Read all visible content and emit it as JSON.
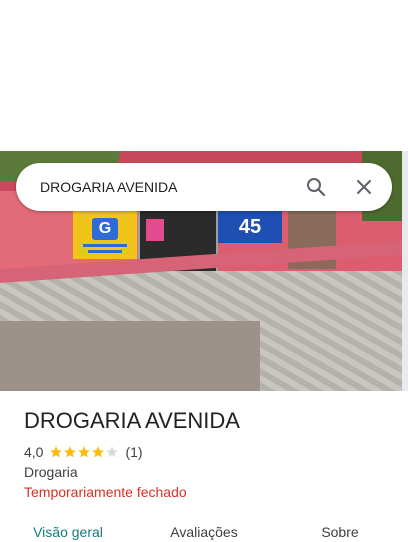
{
  "search": {
    "query": "DROGARIA AVENIDA"
  },
  "place": {
    "name": "DROGARIA AVENIDA",
    "rating": "4,0",
    "rating_value": 4.0,
    "reviews_count": "(1)",
    "category": "Drogaria",
    "status": "Temporariamente fechado"
  },
  "photo_signs": {
    "g_sign": "G",
    "promo_sign": "45"
  },
  "tabs": [
    {
      "label": "Visão geral",
      "active": true
    },
    {
      "label": "Avaliações",
      "active": false
    },
    {
      "label": "Sobre",
      "active": false
    }
  ],
  "colors": {
    "accent_tab": "#137a7f",
    "status_closed": "#d93025",
    "star": "#fbbc04"
  }
}
